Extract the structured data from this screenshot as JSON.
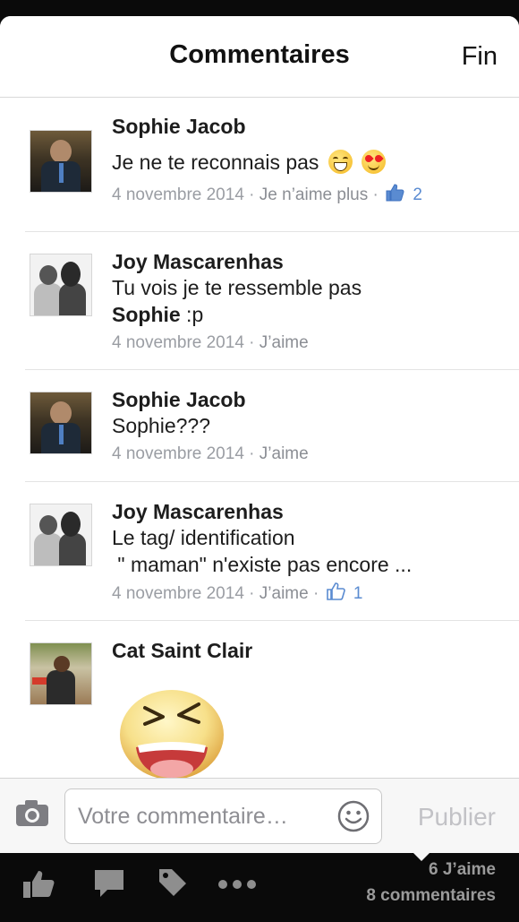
{
  "header": {
    "title": "Commentaires",
    "done_label": "Fin"
  },
  "comments": [
    {
      "author": "Sophie Jacob",
      "text": "Je ne te reconnais pas",
      "emojis": [
        "grinning-face-emoji",
        "heart-eyes-emoji"
      ],
      "date": "4 novembre 2014",
      "like_action": "Je n’aime plus",
      "like_count": "2"
    },
    {
      "author": "Joy Mascarenhas",
      "text_line1": "Tu vois je te ressemble pas",
      "mention": "Sophie",
      "text_after_mention": " :p",
      "date": "4 novembre 2014",
      "like_action": "J’aime"
    },
    {
      "author": "Sophie Jacob",
      "text": "Sophie???",
      "date": "4 novembre 2014",
      "like_action": "J’aime"
    },
    {
      "author": "Joy Mascarenhas",
      "text_line1": "Le tag/ identification",
      "text_line2": " \" maman\" n'existe pas encore ...",
      "date": "4 novembre 2014",
      "like_action": "J’aime",
      "like_count": "1"
    },
    {
      "author": "Cat Saint Clair",
      "sticker": "laughing-face-sticker"
    }
  ],
  "composer": {
    "placeholder": "Votre commentaire…",
    "publish_label": "Publier",
    "camera_icon": "camera-icon",
    "emoji_icon": "smiley-icon"
  },
  "bottom_bar": {
    "icons": [
      "like-icon",
      "comment-icon",
      "tag-icon",
      "more-icon"
    ],
    "likes_summary": "6 J’aime",
    "comments_summary": "8 commentaires"
  },
  "colors": {
    "accent": "#5a8bd1",
    "meta_text": "#9a9da3",
    "bar_bg": "#0a0a0a"
  }
}
